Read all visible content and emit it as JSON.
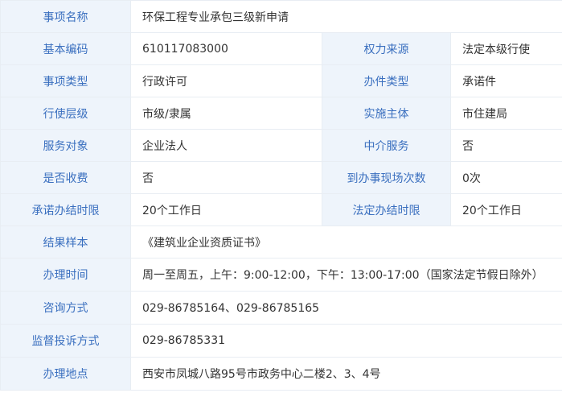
{
  "rows": {
    "item_name": {
      "label": "事项名称",
      "value": "环保工程专业承包三级新申请"
    },
    "basic_code": {
      "label": "基本编码",
      "value": "610117083000"
    },
    "power_source": {
      "label": "权力来源",
      "value": "法定本级行使"
    },
    "item_type": {
      "label": "事项类型",
      "value": "行政许可"
    },
    "handling_type": {
      "label": "办件类型",
      "value": "承诺件"
    },
    "exercise_level": {
      "label": "行使层级",
      "value": "市级/隶属"
    },
    "implementing_body": {
      "label": "实施主体",
      "value": "市住建局"
    },
    "service_object": {
      "label": "服务对象",
      "value": "企业法人"
    },
    "intermediary": {
      "label": "中介服务",
      "value": "否"
    },
    "fee": {
      "label": "是否收费",
      "value": "否"
    },
    "site_visits": {
      "label": "到办事现场次数",
      "value": "0次"
    },
    "promised_time": {
      "label": "承诺办结时限",
      "value": "20个工作日"
    },
    "legal_time": {
      "label": "法定办结时限",
      "value": "20个工作日"
    },
    "result_sample": {
      "label": "结果样本",
      "value": "《建筑业企业资质证书》"
    },
    "office_hours": {
      "label": "办理时间",
      "value": "周一至周五，上午：9:00-12:00，下午：13:00-17:00（国家法定节假日除外）"
    },
    "consult": {
      "label": "咨询方式",
      "value": "029-86785164、029-86785165"
    },
    "complaint": {
      "label": "监督投诉方式",
      "value": "029-86785331"
    },
    "location": {
      "label": "办理地点",
      "value": "西安市凤城八路95号市政务中心二楼2、3、4号"
    }
  }
}
